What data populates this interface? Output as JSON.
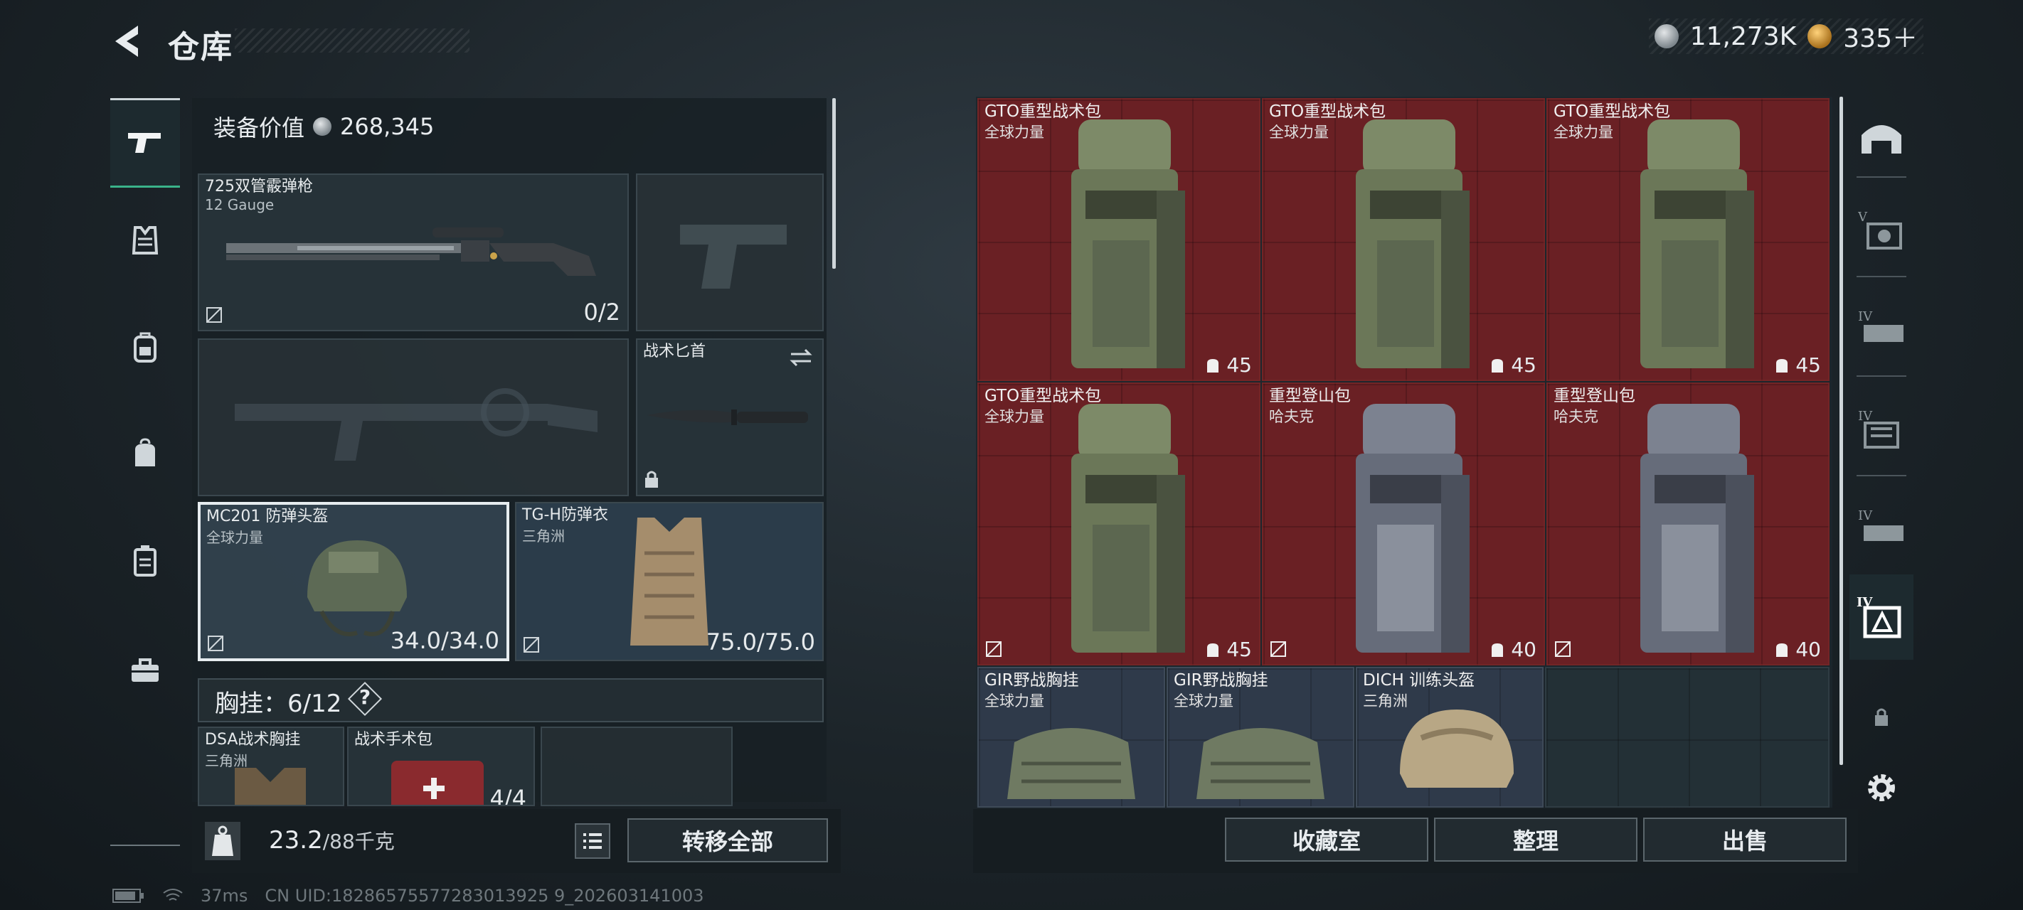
{
  "header": {
    "title": "仓库",
    "currency_silver": "11,273K",
    "currency_gold": "335＋"
  },
  "left_nav": {
    "items": [
      {
        "icon": "pistol-icon",
        "active": true
      },
      {
        "icon": "vest-icon"
      },
      {
        "icon": "backpack-icon"
      },
      {
        "icon": "bag-icon"
      },
      {
        "icon": "case-icon"
      },
      {
        "icon": "toolbox-icon"
      }
    ]
  },
  "loadout": {
    "equip_value_label": "装备价值",
    "equip_value": "268,345",
    "primary_weapon": {
      "name": "725双管霰弹枪",
      "sub": "12 Gauge",
      "value": "0/2"
    },
    "melee": {
      "name": "战术匕首"
    },
    "helmet": {
      "name": "MC201 防弹头盔",
      "sub": "全球力量",
      "value": "34.0/34.0"
    },
    "armor": {
      "name": "TG-H防弹衣",
      "sub": "三角洲",
      "value": "75.0/75.0"
    },
    "chest_rig_label": "胸挂：6/12",
    "help": "?",
    "rig_items": [
      {
        "name": "DSA战术胸挂",
        "sub": "三角洲"
      },
      {
        "name": "战术手术包",
        "value": "4/4"
      }
    ],
    "weight": "23.2",
    "weight_max": "/88千克",
    "transfer_all": "转移全部"
  },
  "inventory": {
    "items": [
      {
        "name": "GTO重型战术包",
        "sub": "全球力量",
        "capacity": "45"
      },
      {
        "name": "GTO重型战术包",
        "sub": "全球力量",
        "capacity": "45"
      },
      {
        "name": "GTO重型战术包",
        "sub": "全球力量",
        "capacity": "45"
      },
      {
        "name": "GTO重型战术包",
        "sub": "全球力量",
        "capacity": "45"
      },
      {
        "name": "重型登山包",
        "sub": "哈夫克",
        "capacity": "40"
      },
      {
        "name": "重型登山包",
        "sub": "哈夫克",
        "capacity": "40"
      },
      {
        "name": "GIR野战胸挂",
        "sub": "全球力量"
      },
      {
        "name": "GIR野战胸挂",
        "sub": "全球力量"
      },
      {
        "name": "DICH 训练头盔",
        "sub": "三角洲"
      }
    ],
    "buttons": {
      "collection": "收藏室",
      "organize": "整理",
      "sell": "出售"
    }
  },
  "right_nav": {
    "items": [
      {
        "icon": "bunker-icon"
      },
      {
        "icon": "storage-v-icon",
        "label": "V"
      },
      {
        "icon": "storage-iv-icon",
        "label": "IV"
      },
      {
        "icon": "storage-iv-icon",
        "label": "IV"
      },
      {
        "icon": "storage-iv-icon",
        "label": "IV"
      },
      {
        "icon": "storage-iv-icon",
        "label": "IV",
        "active": true
      },
      {
        "icon": "lock-icon"
      },
      {
        "icon": "gear-icon"
      }
    ]
  },
  "status": {
    "ping": "37ms",
    "uid": "CN UID:18286575577283013925 9_202603141003"
  }
}
